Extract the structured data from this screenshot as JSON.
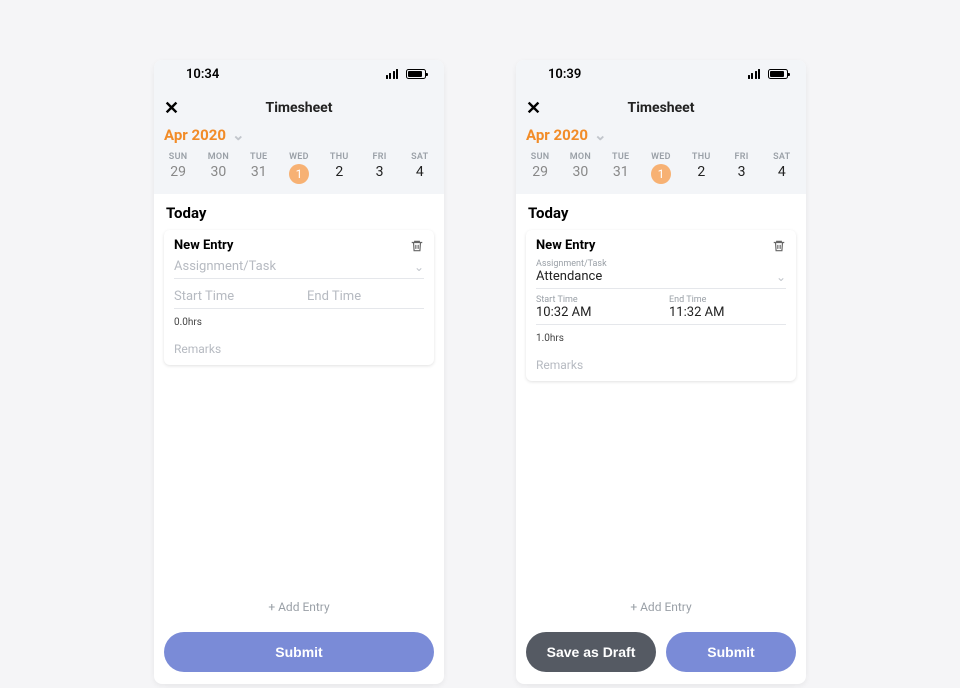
{
  "screens": [
    {
      "statusTime": "10:34",
      "title": "Timesheet",
      "month": "Apr 2020",
      "week": [
        {
          "dow": "SUN",
          "num": "29"
        },
        {
          "dow": "MON",
          "num": "30"
        },
        {
          "dow": "TUE",
          "num": "31"
        },
        {
          "dow": "WED",
          "num": "1",
          "selected": true
        },
        {
          "dow": "THU",
          "num": "2"
        },
        {
          "dow": "FRI",
          "num": "3"
        },
        {
          "dow": "SAT",
          "num": "4"
        }
      ],
      "todayHeading": "Today",
      "entry": {
        "title": "New Entry",
        "assignmentLabel": "Assignment/Task",
        "assignmentValue": "",
        "startLabel": "Start Time",
        "startValue": "",
        "endLabel": "End Time",
        "endValue": "",
        "hours": "0.0hrs",
        "remarksPlaceholder": "Remarks"
      },
      "addEntry": "+ Add Entry",
      "buttons": {
        "submit": "Submit"
      }
    },
    {
      "statusTime": "10:39",
      "title": "Timesheet",
      "month": "Apr 2020",
      "week": [
        {
          "dow": "SUN",
          "num": "29"
        },
        {
          "dow": "MON",
          "num": "30"
        },
        {
          "dow": "TUE",
          "num": "31"
        },
        {
          "dow": "WED",
          "num": "1",
          "selected": true
        },
        {
          "dow": "THU",
          "num": "2"
        },
        {
          "dow": "FRI",
          "num": "3"
        },
        {
          "dow": "SAT",
          "num": "4"
        }
      ],
      "todayHeading": "Today",
      "entry": {
        "title": "New Entry",
        "assignmentLabel": "Assignment/Task",
        "assignmentValue": "Attendance",
        "startLabel": "Start Time",
        "startValue": "10:32 AM",
        "endLabel": "End Time",
        "endValue": "11:32 AM",
        "hours": "1.0hrs",
        "remarksPlaceholder": "Remarks"
      },
      "addEntry": "+ Add Entry",
      "buttons": {
        "draft": "Save as Draft",
        "submit": "Submit"
      }
    }
  ]
}
